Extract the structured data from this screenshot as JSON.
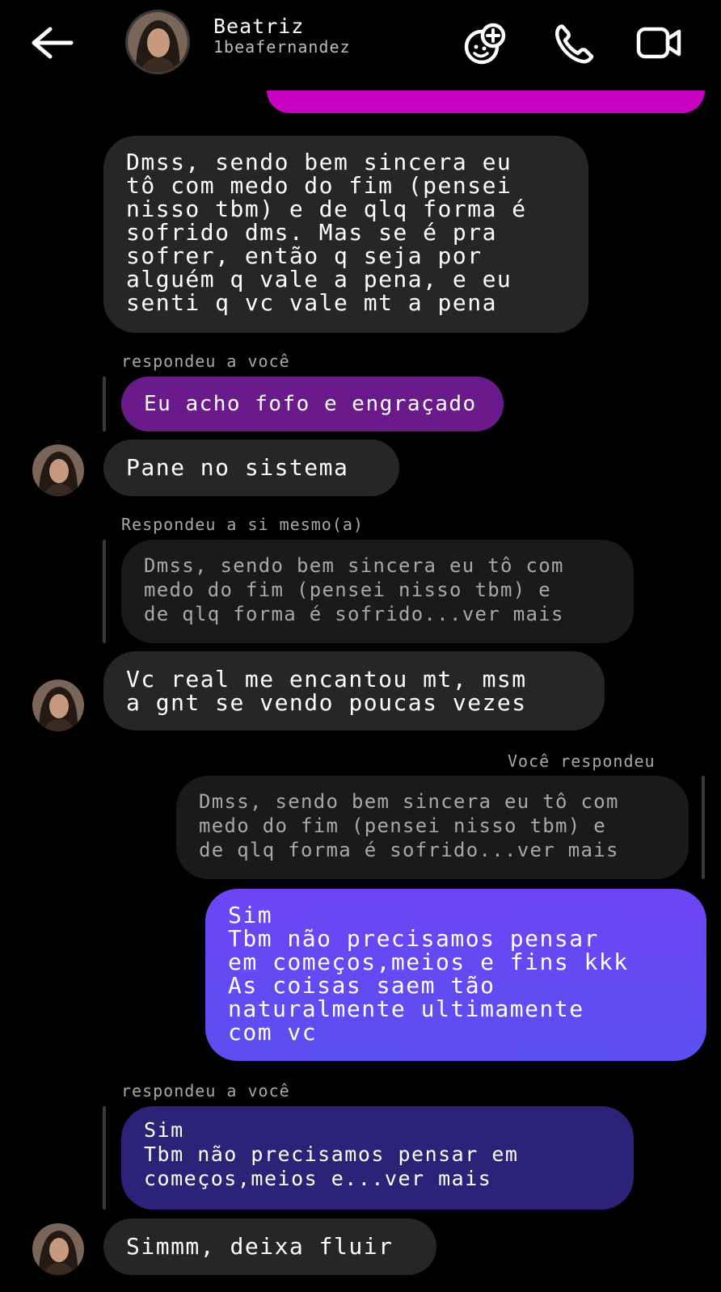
{
  "header": {
    "name": "Beatriz",
    "handle": "1beafernandez",
    "back_icon": "arrow-left-icon",
    "effects_icon": "face-effects-icon",
    "call_icon": "phone-icon",
    "video_icon": "video-camera-icon"
  },
  "colors": {
    "background": "#000000",
    "incoming_bubble": "#262626",
    "quoted_bubble": "#1a1a1a",
    "quoted_purple": "#6b1a8c",
    "outgoing_blue": "#6a47f2",
    "quoted_indigo": "#2c2378",
    "outgoing_magenta": "#c800c0"
  },
  "messages": {
    "m1": "Dmss, sendo bem sincera eu\ntô com medo do fim (pensei\nnisso tbm) e de qlq forma é\nsofrido dms. Mas se é pra\nsofrer, então q seja por\nalguém q vale a pena, e eu\nsenti q vc vale mt a pena",
    "reply1_label": "respondeu a você",
    "reply1_quote": "Eu acho fofo e engraçado",
    "m2": "Pane no sistema",
    "reply2_label": "Respondeu a si mesmo(a)",
    "reply2_quote": "Dmss, sendo bem sincera eu tô com\nmedo do fim (pensei nisso tbm) e\nde qlq forma é sofrido...ver mais",
    "m3": "Vc real me encantou mt, msm\na gnt se vendo poucas vezes",
    "reply3_label": "Você respondeu",
    "reply3_quote": "Dmss, sendo bem sincera eu tô com\nmedo do fim (pensei nisso tbm) e\nde qlq forma é sofrido...ver mais",
    "m4": "Sim\nTbm não precisamos pensar\nem começos,meios e fins kkk\nAs coisas saem tão\nnaturalmente ultimamente\ncom vc",
    "reply4_label": "respondeu a você",
    "reply4_quote": "Sim\nTbm não precisamos pensar em\ncomeços,meios e...ver mais",
    "m5": "Simmm, deixa fluir"
  }
}
